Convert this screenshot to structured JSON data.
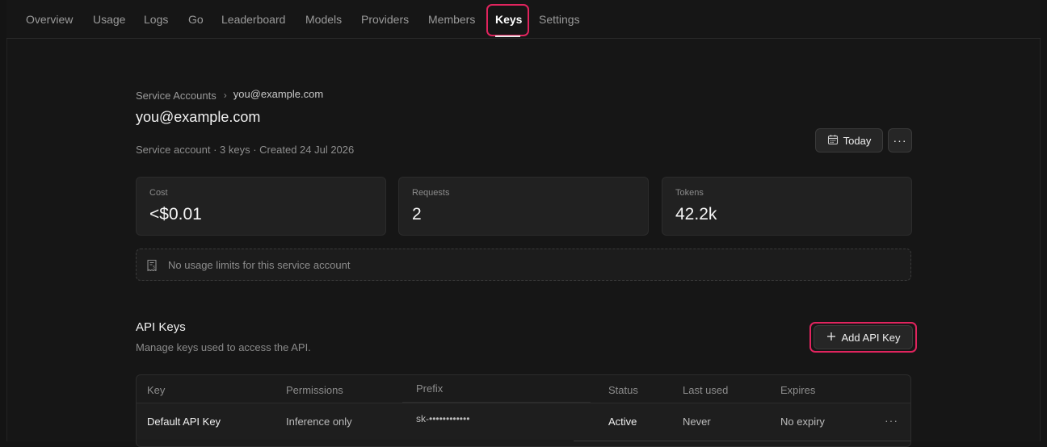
{
  "nav": {
    "items": [
      "Overview",
      "Usage",
      "Logs",
      "Go",
      "Leaderboard",
      "Models",
      "Providers",
      "Members",
      "Keys",
      "Settings"
    ],
    "active": "Keys"
  },
  "breadcrumb": {
    "parent": "Service Accounts",
    "separator": "›",
    "current": "you@example.com"
  },
  "header": {
    "title": "you@example.com",
    "subtitle": "Service account · 3 keys · Created 24 Jul 2026",
    "date_button": "Today",
    "more_label": "···"
  },
  "stats": [
    {
      "label": "Cost",
      "value": "<$0.01"
    },
    {
      "label": "Requests",
      "value": "2"
    },
    {
      "label": "Tokens",
      "value": "42.2k"
    }
  ],
  "limits_notice": "No usage limits for this service account",
  "api_keys": {
    "title": "API Keys",
    "subtitle": "Manage keys used to access the API.",
    "add_button": "Add API Key",
    "columns": [
      "Key",
      "Permissions",
      "Prefix",
      "Status",
      "Last used",
      "Expires"
    ],
    "rows": [
      {
        "key": "Default API Key",
        "permissions": "Inference only",
        "prefix": "sk-••••••••••••",
        "status": "Active",
        "last_used": "Never",
        "expires": "No expiry",
        "more": "···"
      }
    ]
  },
  "colors": {
    "accent_highlight": "#e0245e",
    "background": "#161616",
    "card": "#212121"
  }
}
